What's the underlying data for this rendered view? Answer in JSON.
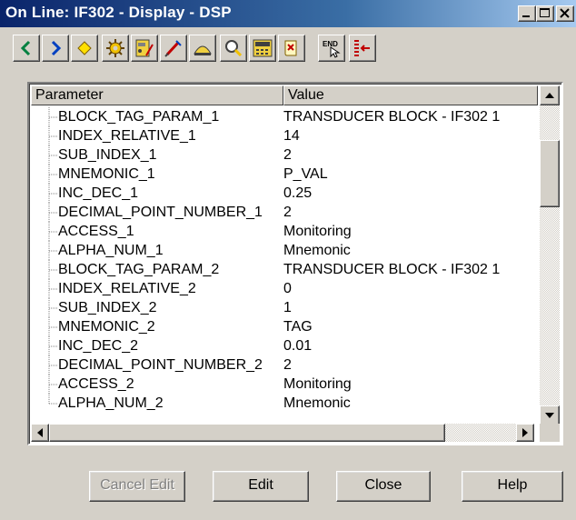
{
  "window": {
    "title": "On Line: IF302 - Display - DSP"
  },
  "titlebar_buttons": [
    "minimize-icon",
    "maximize-icon",
    "close-icon"
  ],
  "toolbar": {
    "tools": [
      {
        "name": "back-arrow-icon"
      },
      {
        "name": "forward-arrow-icon"
      },
      {
        "name": "diamond-icon"
      },
      {
        "name": "gear-icon"
      },
      {
        "name": "device-edit-icon"
      },
      {
        "name": "pen-icon"
      },
      {
        "name": "gauge-icon"
      },
      {
        "name": "magnifier-icon"
      },
      {
        "name": "calculator-icon"
      },
      {
        "name": "scroll-icon"
      },
      {
        "name": "end-icon",
        "label": "END"
      },
      {
        "name": "indicator-icon"
      }
    ]
  },
  "grid": {
    "columns": [
      "Parameter",
      "Value"
    ],
    "rows": [
      {
        "parameter": "BLOCK_TAG_PARAM_1",
        "value": "TRANSDUCER BLOCK - IF302 1"
      },
      {
        "parameter": "INDEX_RELATIVE_1",
        "value": "14"
      },
      {
        "parameter": "SUB_INDEX_1",
        "value": "2"
      },
      {
        "parameter": "MNEMONIC_1",
        "value": "P_VAL"
      },
      {
        "parameter": "INC_DEC_1",
        "value": "0.25"
      },
      {
        "parameter": "DECIMAL_POINT_NUMBER_1",
        "value": "2"
      },
      {
        "parameter": "ACCESS_1",
        "value": "Monitoring"
      },
      {
        "parameter": "ALPHA_NUM_1",
        "value": "Mnemonic"
      },
      {
        "parameter": "BLOCK_TAG_PARAM_2",
        "value": "TRANSDUCER BLOCK - IF302 1"
      },
      {
        "parameter": "INDEX_RELATIVE_2",
        "value": "0"
      },
      {
        "parameter": "SUB_INDEX_2",
        "value": "1"
      },
      {
        "parameter": "MNEMONIC_2",
        "value": "TAG"
      },
      {
        "parameter": "INC_DEC_2",
        "value": "0.01"
      },
      {
        "parameter": "DECIMAL_POINT_NUMBER_2",
        "value": "2"
      },
      {
        "parameter": "ACCESS_2",
        "value": "Monitoring"
      },
      {
        "parameter": "ALPHA_NUM_2",
        "value": "Mnemonic"
      }
    ]
  },
  "buttons": {
    "cancel_edit": "Cancel Edit",
    "edit": "Edit",
    "close": "Close",
    "help": "Help"
  },
  "colors": {
    "titlebar_start": "#0a246a",
    "titlebar_end": "#a6caf0",
    "face": "#d4d0c8"
  }
}
